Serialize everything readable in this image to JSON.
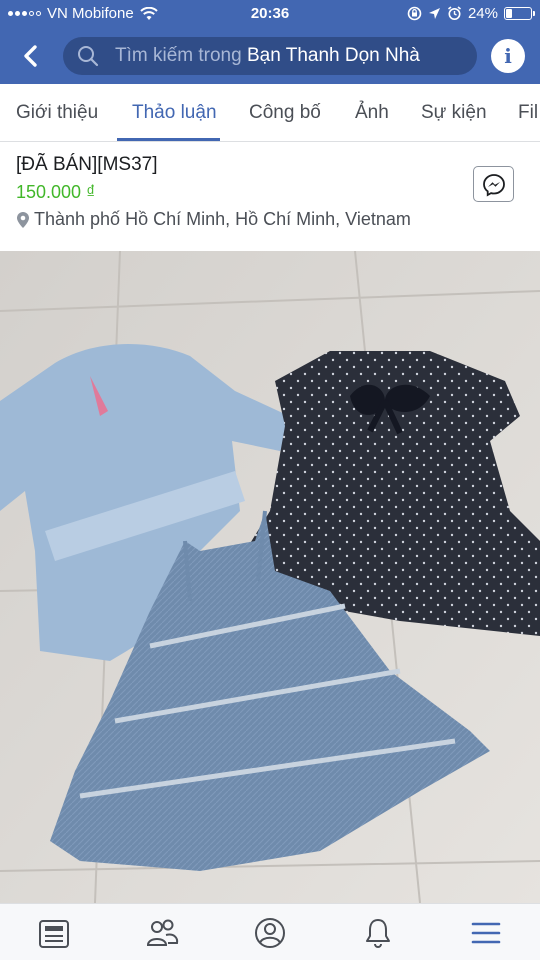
{
  "status_bar": {
    "carrier": "VN Mobifone",
    "time": "20:36",
    "battery": "24%",
    "battery_level": 0.24
  },
  "header": {
    "search_prefix": "Tìm kiếm trong ",
    "group_name": "Bạn Thanh Dọn Nhà"
  },
  "tabs": [
    {
      "label": "Giới thiệu",
      "active": false
    },
    {
      "label": "Thảo luận",
      "active": true
    },
    {
      "label": "Công bố",
      "active": false
    },
    {
      "label": "Ảnh",
      "active": false
    },
    {
      "label": "Sự kiện",
      "active": false
    },
    {
      "label": "Fil",
      "active": false
    }
  ],
  "listing": {
    "title": "[ĐÃ BÁN][MS37]",
    "price": "150.000 ₫",
    "location": "Thành phố Hồ Chí Minh, Hồ Chí Minh, Vietnam"
  },
  "bottom_nav": [
    {
      "icon": "news-feed-icon"
    },
    {
      "icon": "groups-icon"
    },
    {
      "icon": "profile-icon"
    },
    {
      "icon": "notifications-icon"
    },
    {
      "icon": "menu-icon"
    }
  ],
  "colors": {
    "brand": "#4267b2",
    "price": "#42b72a",
    "nav_active": "#4267b2"
  }
}
